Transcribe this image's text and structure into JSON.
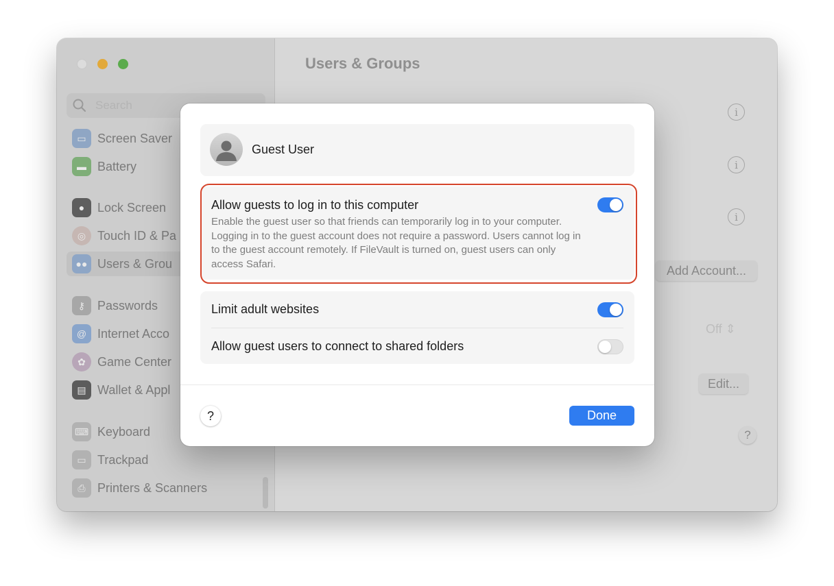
{
  "window": {
    "title": "Users & Groups"
  },
  "sidebar": {
    "search_placeholder": "Search",
    "items": [
      {
        "label": "Screen Saver",
        "icon": "screen-saver-icon",
        "color": "#8fa6c4"
      },
      {
        "label": "Battery",
        "icon": "battery-icon",
        "color": "#7fae78"
      },
      {
        "label": "Lock Screen",
        "icon": "lock-icon",
        "color": "#5e5e5e"
      },
      {
        "label": "Touch ID & Pa",
        "icon": "fingerprint-icon",
        "color": "#c6b7b3"
      },
      {
        "label": "Users & Grou",
        "icon": "users-icon",
        "color": "#8ea6c6"
      },
      {
        "label": "Passwords",
        "icon": "key-icon",
        "color": "#a7a7a7"
      },
      {
        "label": "Internet Acco",
        "icon": "at-icon",
        "color": "#89a5cb"
      },
      {
        "label": "Game Center",
        "icon": "game-center-icon",
        "color": "#b8a6b8"
      },
      {
        "label": "Wallet & Appl",
        "icon": "wallet-icon",
        "color": "#5c5c5c"
      },
      {
        "label": "Keyboard",
        "icon": "keyboard-icon",
        "color": "#b2b2b2"
      },
      {
        "label": "Trackpad",
        "icon": "trackpad-icon",
        "color": "#b2b2b2"
      },
      {
        "label": "Printers & Scanners",
        "icon": "printer-icon",
        "color": "#b2b2b2"
      }
    ]
  },
  "main": {
    "info_glyph": "i",
    "add_account_label": "Add Account...",
    "auto_login_value": "Off",
    "edit_label": "Edit...",
    "help_label": "?"
  },
  "sheet": {
    "user_name": "Guest User",
    "allow_guests": {
      "title": "Allow guests to log in to this computer",
      "description": "Enable the guest user so that friends can temporarily log in to your computer. Logging in to the guest account does not require a password. Users cannot log in to the guest account remotely. If FileVault is turned on, guest users can only access Safari.",
      "enabled": true
    },
    "limit_adult": {
      "title": "Limit adult websites",
      "enabled": true
    },
    "shared_folders": {
      "title": "Allow guest users to connect to shared folders",
      "enabled": false
    },
    "help_label": "?",
    "done_label": "Done"
  },
  "colors": {
    "accent": "#2f7cf0",
    "highlight": "#d5452c"
  }
}
